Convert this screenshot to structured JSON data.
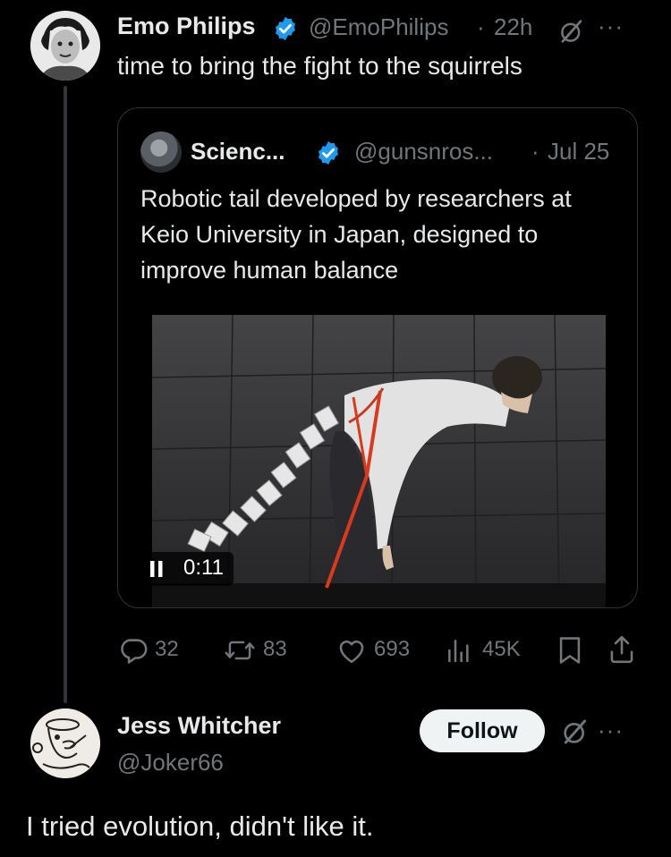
{
  "tweet": {
    "author_name": "Emo Philips",
    "handle": "@EmoPhilips",
    "dot": "·",
    "time": "22h",
    "text": "time to bring the fight to the squirrels",
    "more_glyph": "···"
  },
  "quote": {
    "author_name": "Scienc...",
    "handle": "@gunsnros...",
    "dot": "·",
    "time": "Jul 25",
    "text": "Robotic tail developed by researchers at Keio University in Japan, designed to improve human balance",
    "video_time": "0:11"
  },
  "actions": {
    "replies": "32",
    "reposts": "83",
    "likes": "693",
    "views": "45K"
  },
  "reply": {
    "author_name": "Jess Whitcher",
    "handle": "@Joker66",
    "follow_label": "Follow",
    "text": "I tried evolution, didn't like it.",
    "more_glyph": "···"
  },
  "colors": {
    "background": "#000000",
    "primary_text": "#e7e9ea",
    "secondary_text": "#71767b",
    "verified_blue": "#1d9bf0",
    "follow_bg": "#eff3f4"
  },
  "icons": [
    "verified-badge-icon",
    "grok-icon",
    "more-icon",
    "pause-icon",
    "reply-icon",
    "repost-icon",
    "like-icon",
    "views-icon",
    "bookmark-icon",
    "share-icon"
  ]
}
